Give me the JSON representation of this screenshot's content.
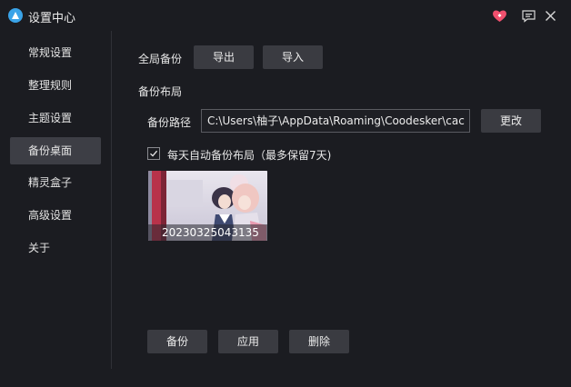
{
  "window": {
    "title": "设置中心"
  },
  "titlebar_icons": [
    "heart-icon",
    "feedback-icon",
    "close-icon"
  ],
  "colors": {
    "background": "#1b1c21",
    "active_nav": "#3d3e45",
    "button": "#3a3b41",
    "accent": "#3aa3e8",
    "heart": "#f0506e"
  },
  "sidebar": {
    "items": [
      {
        "label": "常规设置",
        "active": false
      },
      {
        "label": "整理规则",
        "active": false
      },
      {
        "label": "主题设置",
        "active": false
      },
      {
        "label": "备份桌面",
        "active": true
      },
      {
        "label": "精灵盒子",
        "active": false
      },
      {
        "label": "高级设置",
        "active": false
      },
      {
        "label": "关于",
        "active": false
      }
    ]
  },
  "global_backup": {
    "label": "全局备份",
    "export_label": "导出",
    "import_label": "导入"
  },
  "layout_backup": {
    "heading": "备份布局",
    "path_label": "备份路径",
    "path_value": "C:\\Users\\柚子\\AppData\\Roaming\\Coodesker\\cac",
    "change_label": "更改",
    "auto_backup_label": "每天自动备份布局（最多保留7天)",
    "auto_backup_checked": true,
    "snapshots": [
      {
        "name": "20230325043135"
      }
    ]
  },
  "actions": {
    "backup_label": "备份",
    "apply_label": "应用",
    "delete_label": "删除"
  }
}
